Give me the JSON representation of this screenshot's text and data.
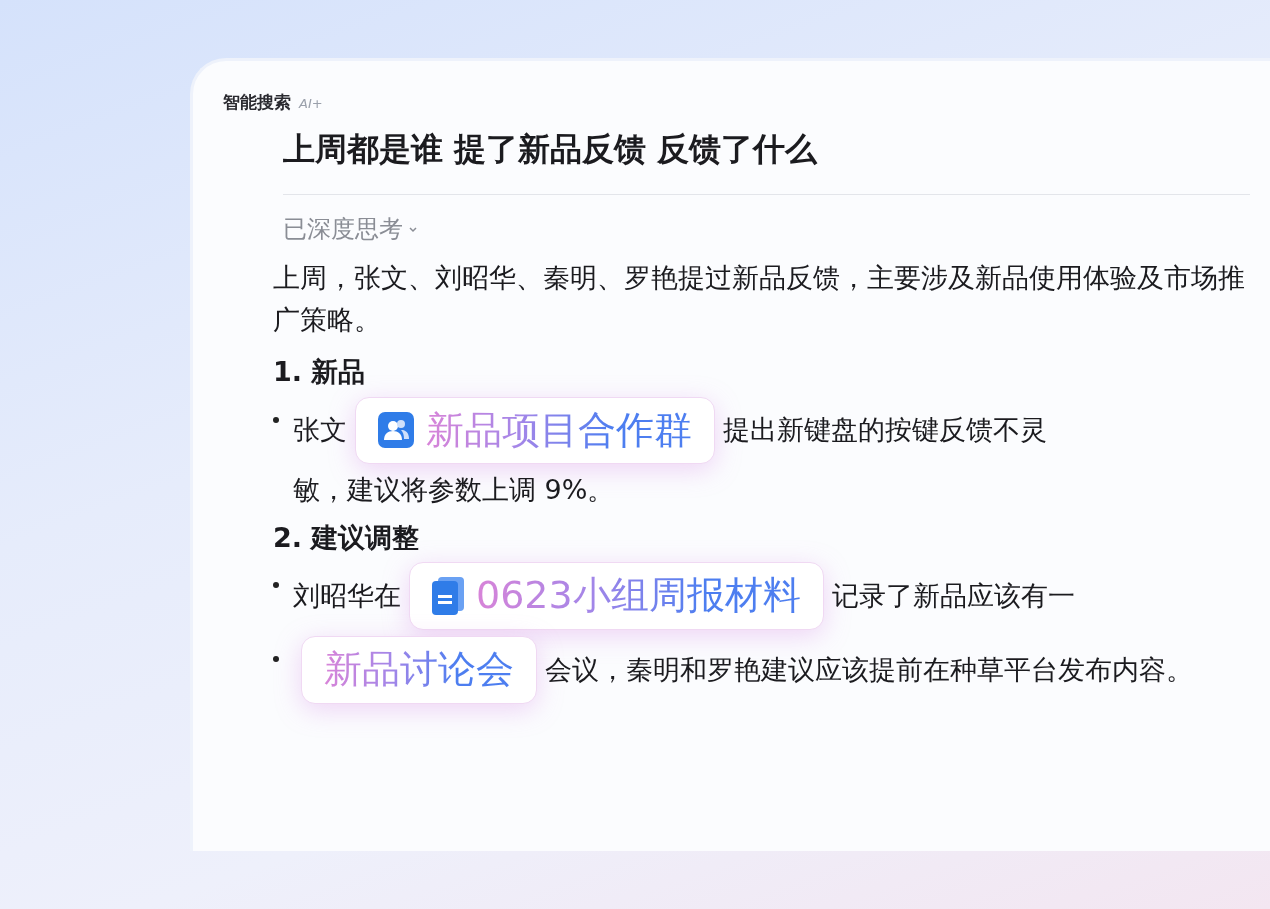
{
  "app": {
    "title": "智能搜索",
    "badge": "AI+"
  },
  "query": "上周都是谁 提了新品反馈 反馈了什么",
  "thinking": {
    "label": "已深度思考",
    "expanded": false
  },
  "answer": {
    "summary": "上周，张文、刘昭华、秦明、罗艳提过新品反馈，主要涉及新品使用体验及市场推广策略。",
    "sections": [
      {
        "heading": "1. 新品",
        "bullets": [
          {
            "segments": [
              {
                "kind": "text",
                "text": "张文"
              },
              {
                "kind": "groupchip",
                "text": "新品项目合作群"
              },
              {
                "kind": "text",
                "text": "提出新键盘的按键反馈不灵"
              },
              {
                "kind": "text",
                "text": "敏，建议将参数上调 9%。"
              }
            ]
          }
        ]
      },
      {
        "heading": "2. 建议调整",
        "bullets": [
          {
            "segments": [
              {
                "kind": "text",
                "text": "刘昭华在"
              },
              {
                "kind": "docchip",
                "text": "0623小组周报材料"
              },
              {
                "kind": "text",
                "text": "记录了新品应该有一"
              }
            ]
          },
          {
            "segments": [
              {
                "kind": "chip",
                "text": "新品讨论会"
              },
              {
                "kind": "text",
                "text": "会议，秦明和罗艳建议应该提前在种草平台发"
              },
              {
                "kind": "text",
                "text": "布内容。"
              }
            ]
          }
        ]
      }
    ]
  }
}
